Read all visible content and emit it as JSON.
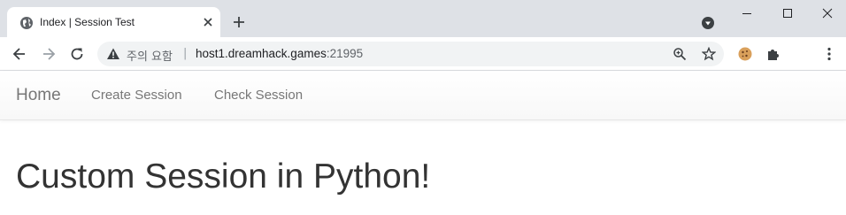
{
  "browser": {
    "tab": {
      "title": "Index | Session Test"
    },
    "address_bar": {
      "security_label": "주의 요함",
      "separator": "|",
      "host": "host1.dreamhack.games",
      "port": ":21995"
    }
  },
  "page": {
    "navbar": {
      "brand": "Home",
      "links": [
        "Create Session",
        "Check Session"
      ]
    },
    "heading": "Custom Session in Python!"
  }
}
